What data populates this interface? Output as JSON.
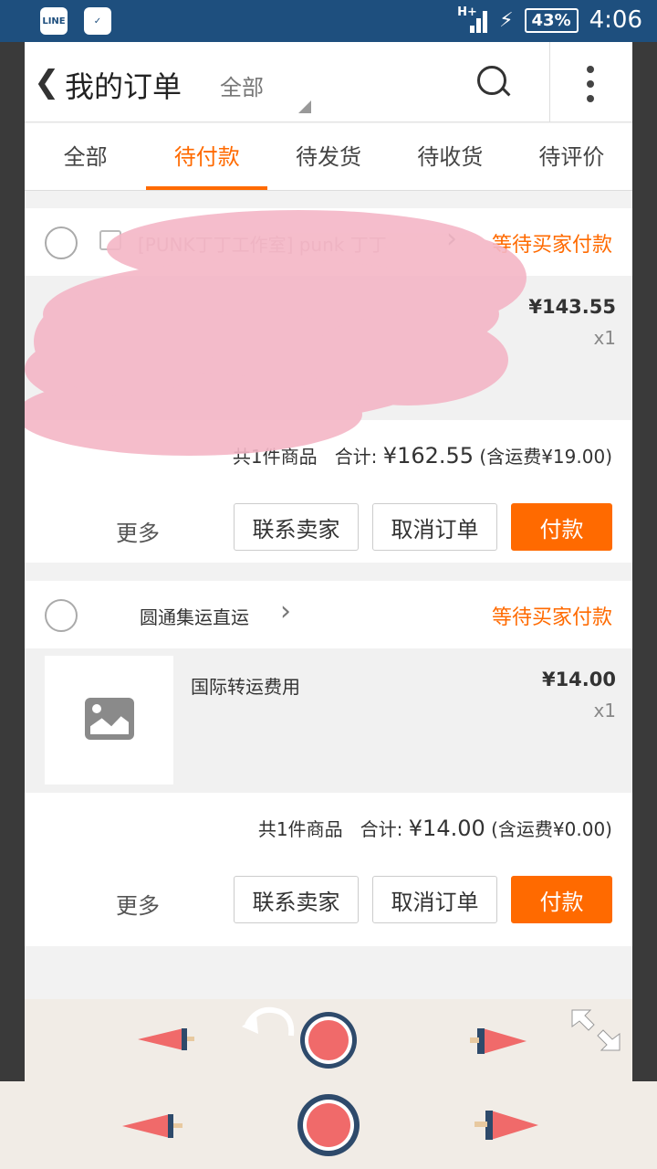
{
  "status_bar": {
    "app_icons": [
      "line-icon",
      "shopping-bag-icon"
    ],
    "network": "H+",
    "battery": "43%",
    "time": "4:06"
  },
  "header": {
    "title": "我的订单",
    "filter_label": "全部"
  },
  "tabs": [
    {
      "label": "全部",
      "active": false
    },
    {
      "label": "待付款",
      "active": true
    },
    {
      "label": "待发货",
      "active": false
    },
    {
      "label": "待收货",
      "active": false
    },
    {
      "label": "待评价",
      "active": false
    }
  ],
  "orders": [
    {
      "shop": "[PUNK丁丁工作室] punk 丁丁",
      "status": "等待买家付款",
      "item_name": "",
      "price": "¥143.55",
      "qty": "x1",
      "summary_count": "共1件商品",
      "summary_total_label": "合计:",
      "summary_total": "¥162.55",
      "summary_shipping": "(含运费¥19.00)",
      "more_label": "更多",
      "contact_label": "联系卖家",
      "cancel_label": "取消订单",
      "pay_label": "付款"
    },
    {
      "shop": "圆通集运直运",
      "status": "等待买家付款",
      "item_name": "国际转运费用",
      "price": "¥14.00",
      "qty": "x1",
      "summary_count": "共1件商品",
      "summary_total_label": "合计:",
      "summary_total": "¥14.00",
      "summary_shipping": "(含运费¥0.00)",
      "more_label": "更多",
      "contact_label": "联系卖家",
      "cancel_label": "取消订单",
      "pay_label": "付款"
    }
  ],
  "colors": {
    "accent": "#ff6a00",
    "status_bar": "#1e4f7e",
    "scribble": "#f4b6c6"
  }
}
